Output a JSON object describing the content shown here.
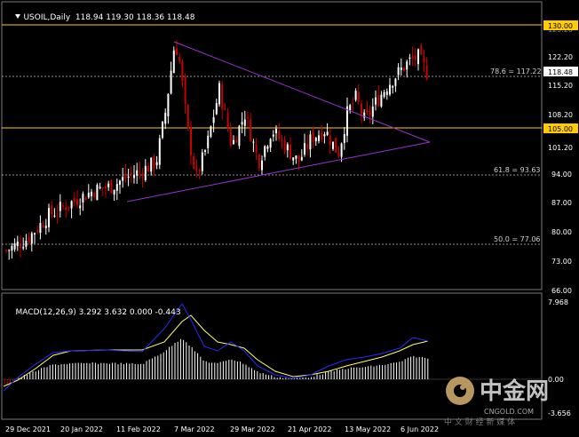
{
  "main_chart": {
    "symbol": "USOIL,Daily",
    "ohlc": "118.94 119.30 118.36 118.48",
    "price_axis": [
      "122.20",
      "115.20",
      "108.20",
      "101.20",
      "94.00",
      "87.00",
      "80.00",
      "73.00",
      "66.00"
    ],
    "levels": {
      "resistance_label": "130.00",
      "support_label": "105.00",
      "current_label": "118.48",
      "fib_786": "78.6 = 117.22",
      "fib_618": "61.8 = 93.63",
      "fib_500": "50.0 = 77.06"
    },
    "hidden_axis_label": "129.20"
  },
  "macd_panel": {
    "label": "MACD(12,26,9) 3.292 3.632 0.000 -0.443",
    "axis_top": "7.968",
    "axis_mid": "0.00",
    "axis_bottom": "-3.656"
  },
  "time_axis": [
    "29 Dec 2021",
    "20 Jan 2022",
    "11 Feb 2022",
    "7 Mar 2022",
    "29 Mar 2022",
    "21 Apr 2022",
    "13 May 2022",
    "6 Jun 2022"
  ],
  "watermark": {
    "brand": "中金网",
    "domain": "CNGOLD.COM",
    "slogan": "中 文 财 经 新 媒 体"
  },
  "colors": {
    "background": "#000000",
    "bull_candle": "#ffffff",
    "bear_candle": "#cc0000",
    "level_line": "#ffcc00",
    "trend_line": "#9933cc",
    "macd_line": "#2a2aff",
    "signal_line": "#ffff66",
    "fib_line": "#909090"
  }
}
